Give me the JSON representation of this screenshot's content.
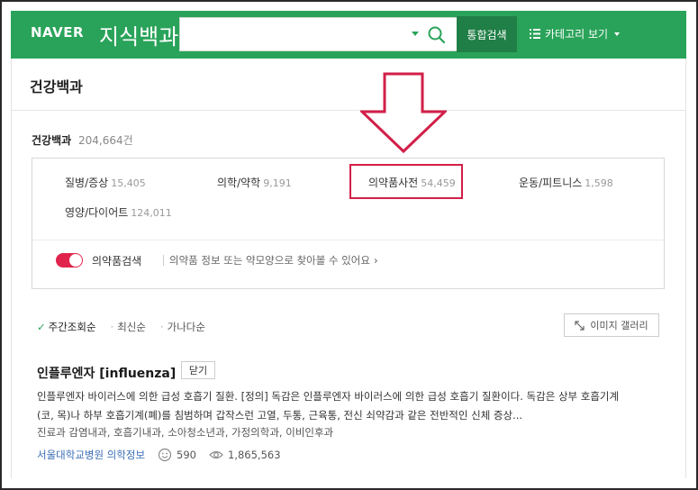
{
  "header": {
    "logo_naver": "NAVER",
    "logo_service": "지식백과",
    "search_value": "",
    "integrated_search_label": "통합검색",
    "category_view_label": "카테고리 보기"
  },
  "page": {
    "title": "건강백과",
    "count_label": "건강백과",
    "count_value": "204,664건"
  },
  "categories": [
    {
      "label": "질병/증상",
      "count": "15,405"
    },
    {
      "label": "의학/약학",
      "count": "9,191"
    },
    {
      "label": "의약품사전",
      "count": "54,459"
    },
    {
      "label": "운동/피트니스",
      "count": "1,598"
    },
    {
      "label": "영양/다이어트",
      "count": "124,011"
    }
  ],
  "drug_search": {
    "label": "의약품검색",
    "description": "의약품 정보 또는 약모양으로 찾아볼 수 있어요",
    "toggle_on": true
  },
  "sort": {
    "options": [
      "주간조회순",
      "최신순",
      "가나다순"
    ],
    "active": "주간조회순",
    "gallery_label": "이미지 갤러리"
  },
  "result": {
    "title": "인플루엔자 [influenza]",
    "close_label": "닫기",
    "description": "인플루엔자 바이러스에 의한 급성 호흡기 질환. [정의] 독감은 인플루엔자 바이러스에 의한 급성 호흡기 질환이다. 독감은 상부 호흡기계(코, 목)나 하부 호흡기계(폐)를 침범하며 갑작스런 고열, 두통, 근육통, 전신 쇠약감과 같은 전반적인 신체 증상...",
    "tags": "진료과  감염내과, 호흡기내과, 소아청소년과, 가정의학과, 이비인후과",
    "source": "서울대학교병원 의학정보",
    "likes": "590",
    "views": "1,865,563"
  },
  "colors": {
    "brand_green": "#2aa35a",
    "highlight_red": "#d21f48"
  }
}
